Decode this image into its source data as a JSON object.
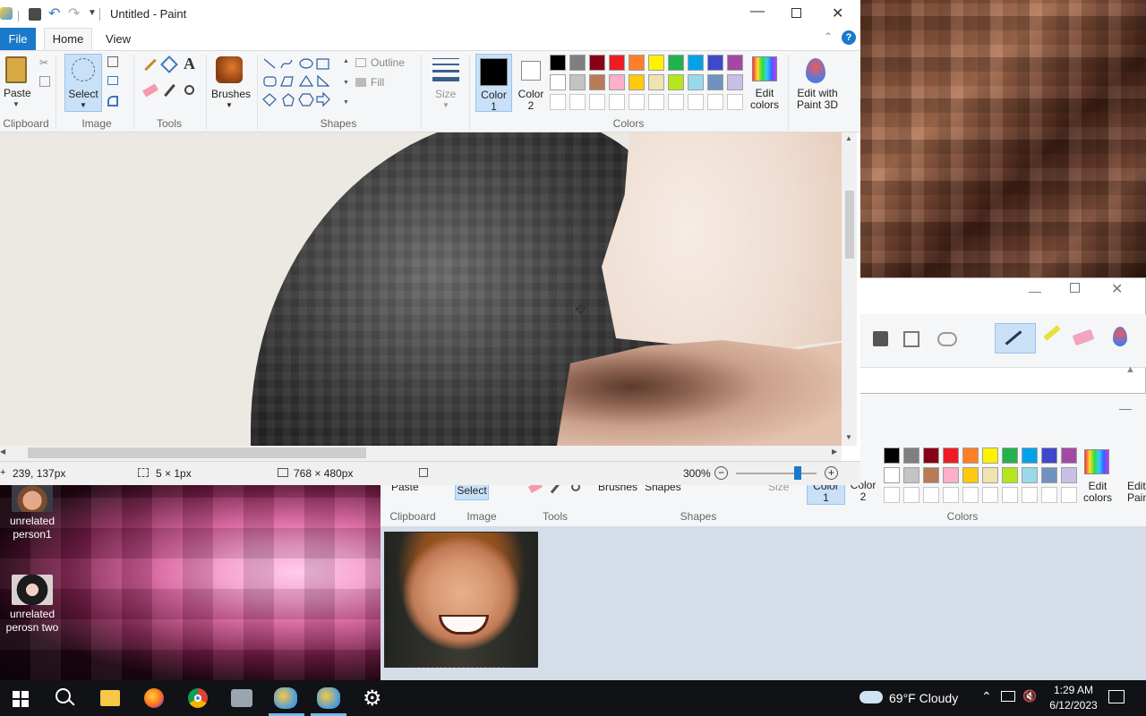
{
  "desktop": {
    "icons": [
      {
        "label_line1": "unrelated",
        "label_line2": "person1"
      },
      {
        "label_line1": "unrelated",
        "label_line2": "perosn two"
      }
    ]
  },
  "paint_main": {
    "title": "Untitled - Paint",
    "tabs": [
      "File",
      "Home",
      "View"
    ],
    "clipboard": {
      "paste": "Paste",
      "group": "Clipboard"
    },
    "image": {
      "select": "Select",
      "group": "Image"
    },
    "tools": {
      "group": "Tools"
    },
    "brushes": {
      "label": "Brushes"
    },
    "shapes": {
      "outline": "Outline",
      "fill": "Fill",
      "group": "Shapes"
    },
    "size": {
      "label": "Size"
    },
    "color1": {
      "label_line1": "Color",
      "label_line2": "1",
      "value": "#000000"
    },
    "color2": {
      "label_line1": "Color",
      "label_line2": "2",
      "value": "#ffffff"
    },
    "colors_group": "Colors",
    "edit_colors": {
      "line1": "Edit",
      "line2": "colors"
    },
    "edit_3d": {
      "line1": "Edit with",
      "line2": "Paint 3D"
    },
    "palette_row1": [
      "#000000",
      "#7f7f7f",
      "#880015",
      "#ed1c24",
      "#ff7f27",
      "#fff200",
      "#22b14c",
      "#00a2e8",
      "#3f48cc",
      "#a349a4"
    ],
    "palette_row2": [
      "#ffffff",
      "#c3c3c3",
      "#b97a57",
      "#ffaec9",
      "#ffc90e",
      "#efe4b0",
      "#b5e61d",
      "#99d9ea",
      "#7092be",
      "#c8bfe7"
    ],
    "status": {
      "cursor_pos": "239, 137px",
      "selection_size": "5 × 1px",
      "image_size": "768 × 480px",
      "zoom": "300%"
    }
  },
  "paint_lower": {
    "ribbon": {
      "paste": "Paste",
      "select": "Select",
      "brushes": "Brushes",
      "shapes": "Shapes",
      "size": "Size",
      "color1_line1": "Color",
      "color1_line2": "1",
      "color2_line1": "Color",
      "color2_line2": "2",
      "edit_colors_line1": "Edit",
      "edit_colors_line2": "colors",
      "edit_3d_line1": "Edit",
      "edit_3d_line2": "Pain",
      "groups": [
        "Clipboard",
        "Image",
        "Tools",
        "Shapes",
        "Colors"
      ]
    }
  },
  "taskbar": {
    "weather": "69°F  Cloudy",
    "time": "1:29 AM",
    "date": "6/12/2023"
  }
}
